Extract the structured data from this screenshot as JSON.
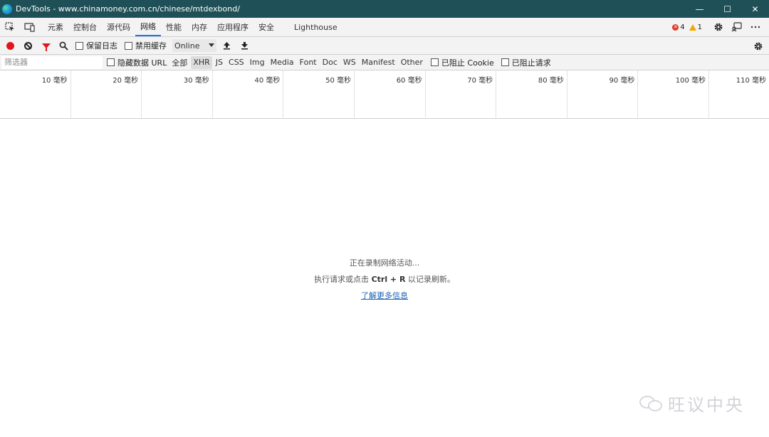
{
  "window": {
    "title": "DevTools - www.chinamoney.com.cn/chinese/mtdexbond/",
    "minimize": "—",
    "maximize": "☐",
    "close": "✕"
  },
  "tabs": [
    {
      "label": "元素"
    },
    {
      "label": "控制台"
    },
    {
      "label": "源代码"
    },
    {
      "label": "网络",
      "active": true
    },
    {
      "label": "性能"
    },
    {
      "label": "内存"
    },
    {
      "label": "应用程序"
    },
    {
      "label": "安全"
    },
    {
      "label": "Lighthouse"
    }
  ],
  "status": {
    "errors": "4",
    "warnings": "1"
  },
  "toolbar": {
    "preserve_log": "保留日志",
    "disable_cache": "禁用缓存",
    "throttling": "Online"
  },
  "filter": {
    "placeholder": "筛选器",
    "hide_data_urls": "隐藏数据 URL",
    "types": [
      "全部",
      "XHR",
      "JS",
      "CSS",
      "Img",
      "Media",
      "Font",
      "Doc",
      "WS",
      "Manifest",
      "Other"
    ],
    "active_type": "XHR",
    "blocked_cookies": "已阻止 Cookie",
    "blocked_requests": "已阻止请求"
  },
  "timeline": {
    "ticks": [
      "10 毫秒",
      "20 毫秒",
      "30 毫秒",
      "40 毫秒",
      "50 毫秒",
      "60 毫秒",
      "70 毫秒",
      "80 毫秒",
      "90 毫秒",
      "100 毫秒",
      "110 毫秒"
    ]
  },
  "empty_state": {
    "recording": "正在录制网络活动...",
    "hint_before": "执行请求或点击 ",
    "hint_shortcut": "Ctrl + R",
    "hint_after": " 以记录刷新。",
    "learn_more": "了解更多信息"
  },
  "watermark": {
    "text": "旺议中央"
  }
}
